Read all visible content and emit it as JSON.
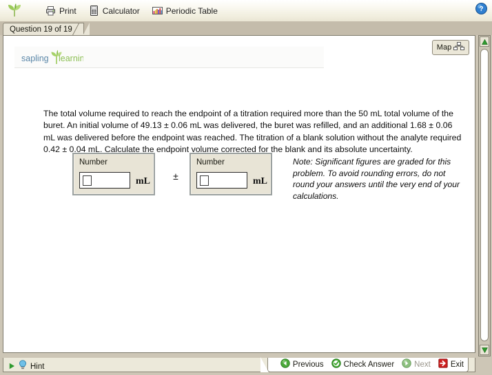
{
  "toolbar": {
    "logo_icon": "sapling-leaf-icon",
    "items": [
      {
        "label": "Print",
        "icon": "printer-icon"
      },
      {
        "label": "Calculator",
        "icon": "calculator-icon"
      },
      {
        "label": "Periodic Table",
        "icon": "periodic-table-icon"
      }
    ],
    "help_icon": "help-question-icon"
  },
  "tabs": [
    {
      "label": "Question 19 of 19",
      "active": true
    }
  ],
  "panel": {
    "brand": {
      "word_one": "sapling",
      "word_two": "learning",
      "word_one_color": "#5b87a8",
      "word_two_color": "#8cbf54",
      "leaf_icon": "sapling-leaf-icon"
    },
    "map_button": {
      "label": "Map",
      "icon": "site-map-icon"
    },
    "question_text": "The total volume required to reach the endpoint of a titration required more than the 50 mL total volume of the buret. An initial volume of 49.13 ± 0.06 mL was delivered, the buret was refilled, and an additional 1.68 ± 0.06 mL was delivered before the endpoint was reached. The titration of a blank solution without the analyte required 0.42 ± 0.04 mL. Calculate the endpoint volume corrected for the blank and its absolute uncertainty.",
    "answer": {
      "box_a": {
        "label": "Number",
        "value": "",
        "unit": "mL"
      },
      "separator": "±",
      "box_b": {
        "label": "Number",
        "value": "",
        "unit": "mL"
      }
    },
    "note": "Note: Significant figures are graded for this problem. To avoid rounding errors, do not round your answers until the very end of your calculations."
  },
  "scrollbar": {
    "up_icon": "triangle-up-icon",
    "down_icon": "triangle-down-icon",
    "arrow_color": "#2e9a2e"
  },
  "bottom": {
    "hint": {
      "label": "Hint",
      "play_icon": "play-triangle-icon",
      "bulb_icon": "lightbulb-icon"
    },
    "nav": [
      {
        "label": "Previous",
        "icon": "arrow-left-circle-icon",
        "disabled": false
      },
      {
        "label": "Check Answer",
        "icon": "check-circle-icon",
        "disabled": false
      },
      {
        "label": "Next",
        "icon": "arrow-right-circle-icon",
        "disabled": true
      },
      {
        "label": "Exit",
        "icon": "exit-door-icon",
        "disabled": false
      }
    ]
  },
  "colors": {
    "toolbar_top": "#ffffff",
    "toolbar_bottom": "#eae6d4",
    "tabstrip": "#c4bcab",
    "panel_chrome": "#cdc6b6",
    "tab_active": "#e9e5d7",
    "accent_green": "#2e9a2e",
    "exit_red": "#cc1f1f",
    "answer_box_fill": "#e8e4d6",
    "answer_box_border": "#9ba1a0"
  }
}
